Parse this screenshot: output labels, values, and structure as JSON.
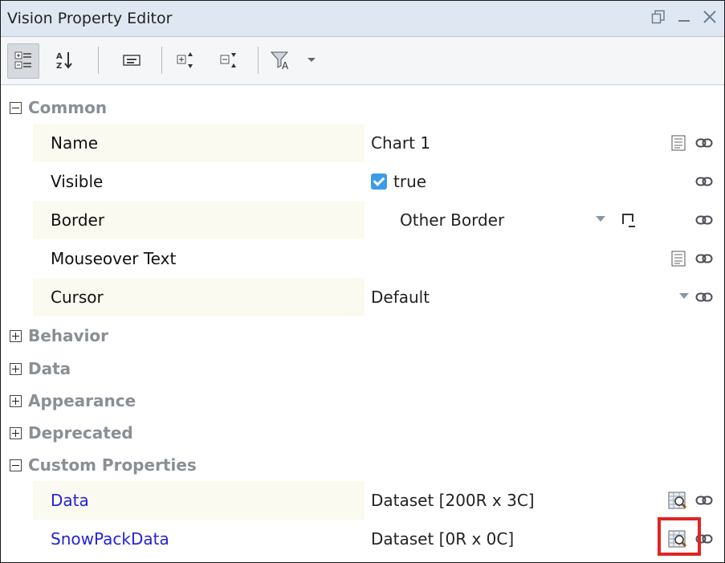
{
  "window": {
    "title": "Vision Property Editor",
    "restore_icon": "restore-icon",
    "minimize_icon": "minimize-icon",
    "close_icon": "close-icon"
  },
  "toolbar": {
    "buttons": [
      {
        "icon": "categorized-view-icon",
        "selected": true
      },
      {
        "icon": "sort-alphabetical-icon",
        "selected": false
      },
      {
        "icon": "description-panel-icon",
        "selected": false
      },
      {
        "icon": "expand-all-icon",
        "selected": false
      },
      {
        "icon": "collapse-all-icon",
        "selected": false
      },
      {
        "icon": "filter-icon",
        "selected": false
      },
      {
        "icon": "dropdown-arrow-icon",
        "selected": false
      }
    ]
  },
  "categories": {
    "common": {
      "label": "Common",
      "expanded": true
    },
    "behavior": {
      "label": "Behavior",
      "expanded": false
    },
    "data": {
      "label": "Data",
      "expanded": false
    },
    "appearance": {
      "label": "Appearance",
      "expanded": false
    },
    "deprecated": {
      "label": "Deprecated",
      "expanded": false
    },
    "custom": {
      "label": "Custom Properties",
      "expanded": true
    }
  },
  "common_props": {
    "name": {
      "label": "Name",
      "value": "Chart 1"
    },
    "visible": {
      "label": "Visible",
      "value": "true",
      "checked": true
    },
    "border": {
      "label": "Border",
      "value": "Other Border"
    },
    "mouseover": {
      "label": "Mouseover Text",
      "value": ""
    },
    "cursor": {
      "label": "Cursor",
      "value": "Default"
    }
  },
  "custom_props": {
    "data": {
      "label": "Data",
      "value": "Dataset [200R x 3C]"
    },
    "snowpack": {
      "label": "SnowPackData",
      "value": "Dataset [0R x 0C]"
    }
  },
  "colors": {
    "custom_label": "#2323d6",
    "highlight": "#e02424",
    "checkbox": "#3d9be9",
    "titlebar": "#dfe8f2"
  }
}
